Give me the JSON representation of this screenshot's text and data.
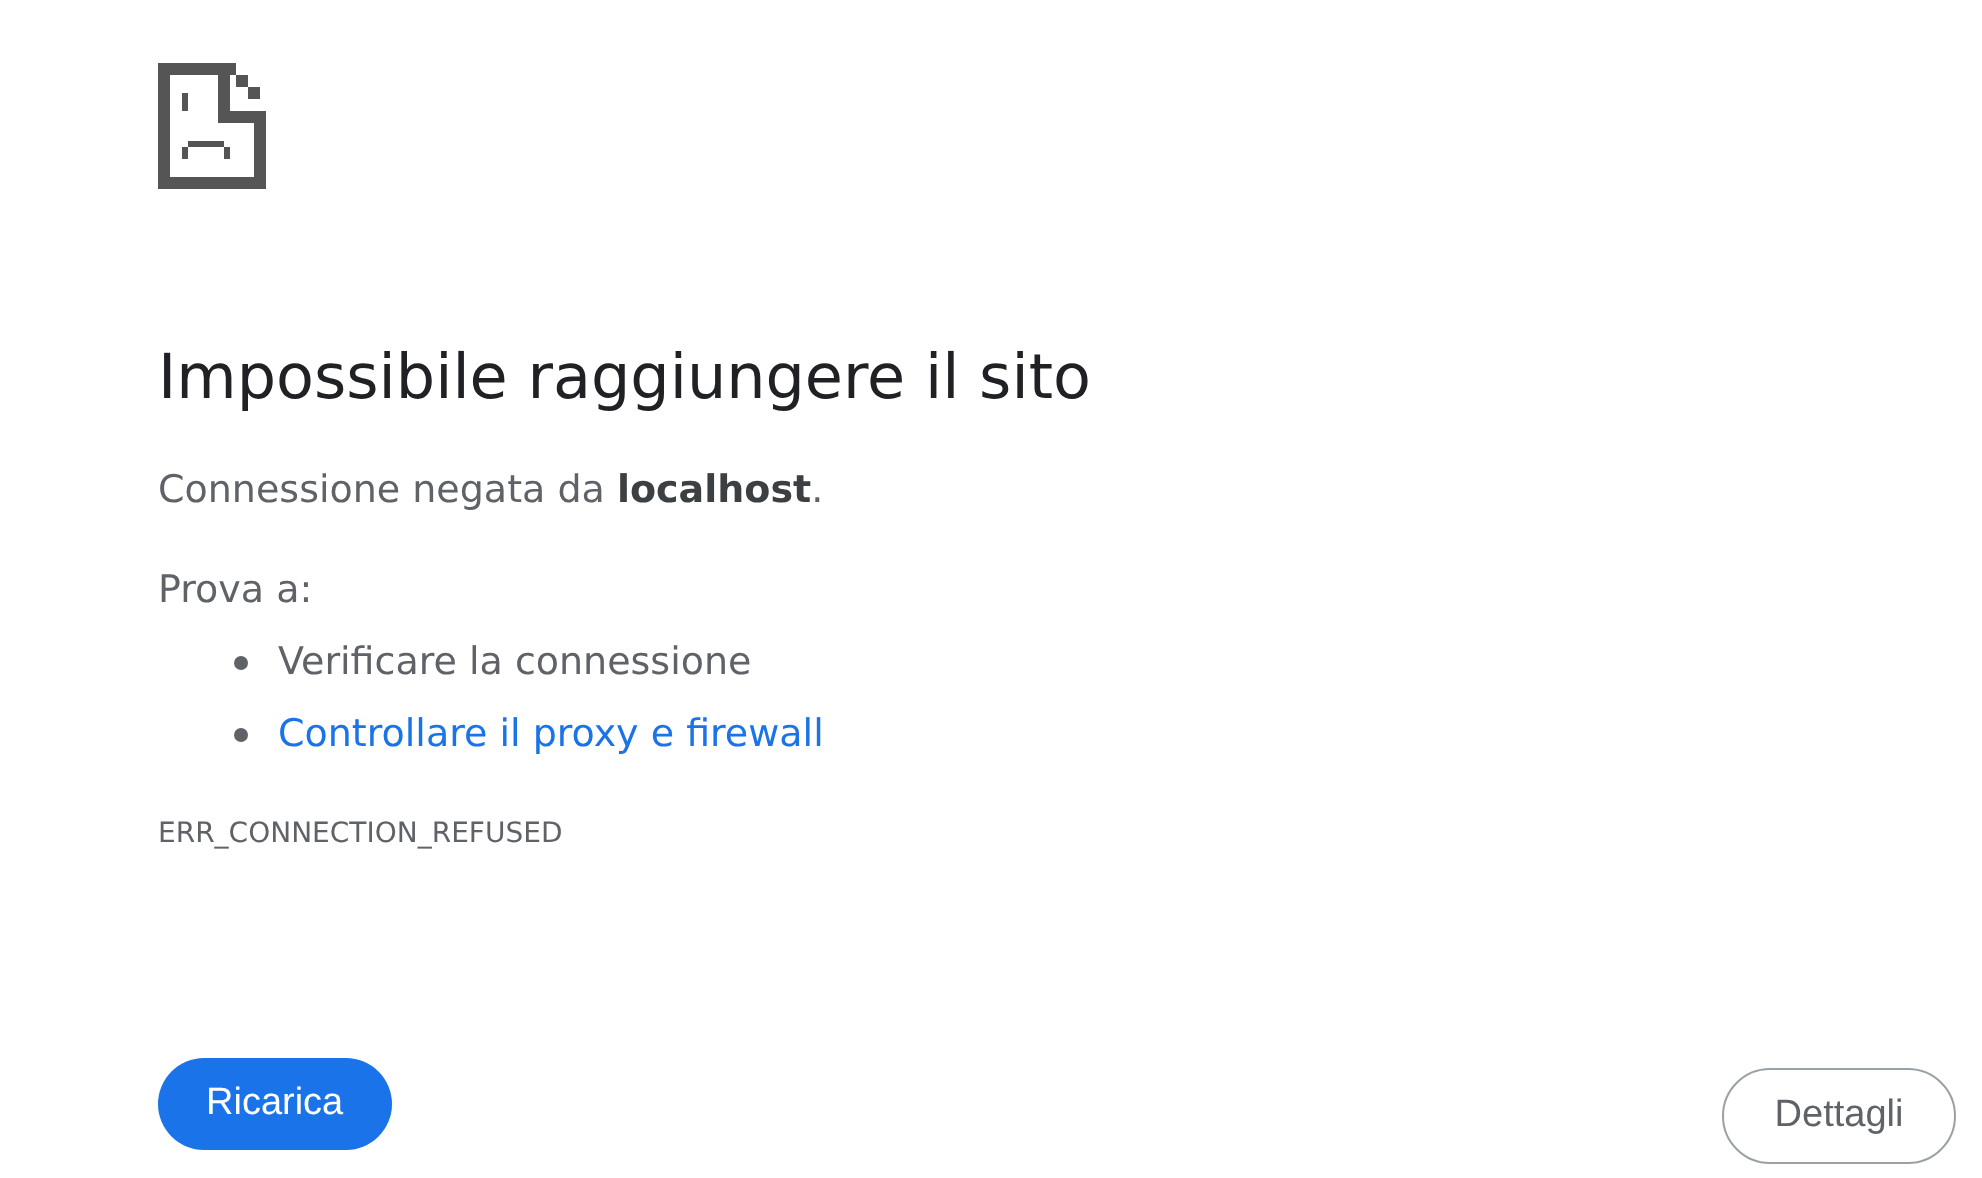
{
  "error": {
    "title": "Impossibile raggiungere il sito",
    "message": "Connessione negata da **localhost**.",
    "suggestions_heading": "Prova a:",
    "suggestions": [
      {
        "kind": "text",
        "label": "Verificare la connessione"
      },
      {
        "kind": "link",
        "label": "Controllare il proxy e firewall"
      }
    ],
    "code": "ERR_CONNECTION_REFUSED"
  },
  "buttons": {
    "primary": "Ricarica",
    "secondary": "Dettagli"
  }
}
